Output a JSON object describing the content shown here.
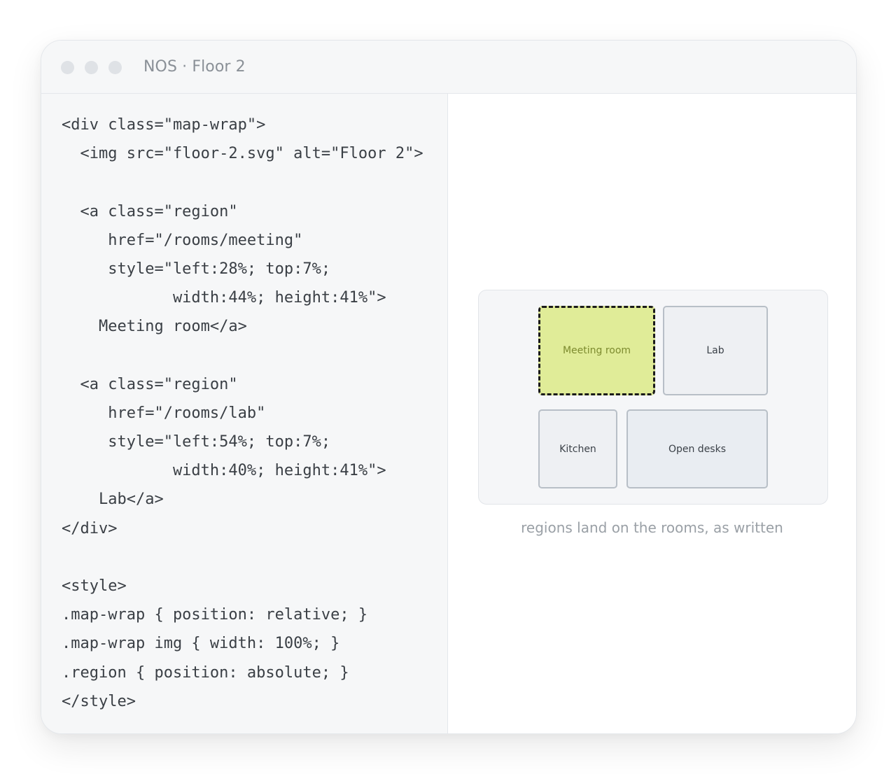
{
  "window": {
    "title": "NOS · Floor 2"
  },
  "code": {
    "lines": [
      "<div class=\"map-wrap\">",
      "  <img src=\"floor-2.svg\" alt=\"Floor 2\">",
      "",
      "  <a class=\"region\"",
      "     href=\"/rooms/meeting\"",
      "     style=\"left:28%; top:7%;",
      "            width:44%; height:41%\">",
      "    Meeting room</a>",
      "",
      "  <a class=\"region\"",
      "     href=\"/rooms/lab\"",
      "     style=\"left:54%; top:7%;",
      "            width:40%; height:41%\">",
      "    Lab</a>",
      "</div>",
      "",
      "<style>",
      ".map-wrap { position: relative; }",
      ".map-wrap img { width: 100%; }",
      ".region { position: absolute; }",
      "</style>"
    ]
  },
  "preview": {
    "rooms": {
      "meeting": "Meeting room",
      "lab": "Lab",
      "kitchen": "Kitchen",
      "open_desks": "Open desks"
    },
    "caption": "regions land on the rooms, as written"
  },
  "colors": {
    "meeting_highlight": "#e0ec98",
    "meeting_border": "#1a1a1a",
    "meeting_text": "#7d8b2f",
    "room_fill": "#eef0f3",
    "room_border": "#b8bfc7"
  }
}
